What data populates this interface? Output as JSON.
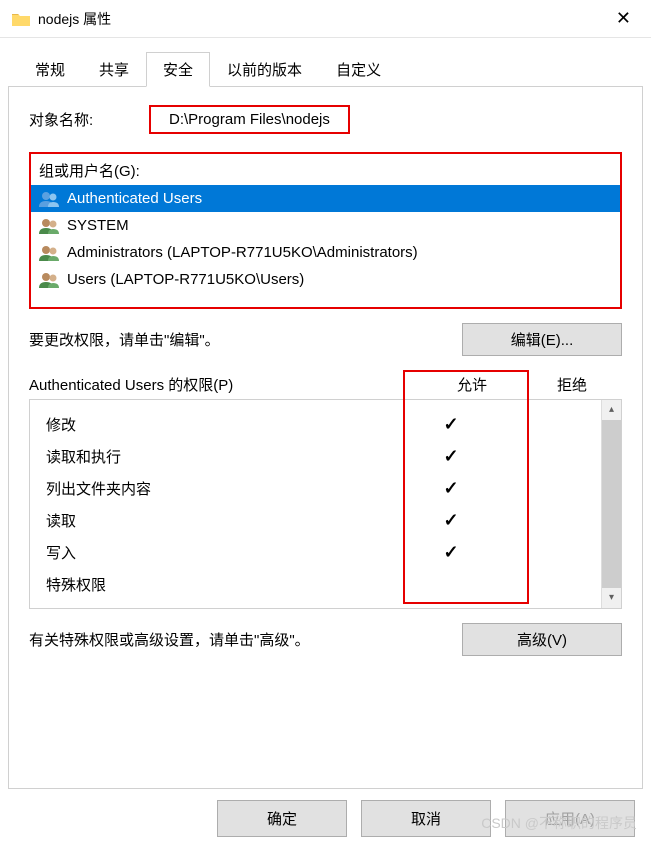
{
  "window": {
    "title": "nodejs 属性"
  },
  "tabs": [
    {
      "label": "常规"
    },
    {
      "label": "共享"
    },
    {
      "label": "安全",
      "active": true
    },
    {
      "label": "以前的版本"
    },
    {
      "label": "自定义"
    }
  ],
  "object": {
    "label": "对象名称:",
    "path": "D:\\Program Files\\nodejs"
  },
  "groups": {
    "label": "组或用户名(G):",
    "items": [
      {
        "name": "Authenticated Users",
        "selected": true
      },
      {
        "name": "SYSTEM"
      },
      {
        "name": "Administrators (LAPTOP-R771U5KO\\Administrators)"
      },
      {
        "name": "Users (LAPTOP-R771U5KO\\Users)"
      }
    ]
  },
  "edit": {
    "text": "要更改权限，请单击\"编辑\"。",
    "button": "编辑(E)..."
  },
  "perm": {
    "header": "Authenticated Users 的权限(P)",
    "allow": "允许",
    "deny": "拒绝",
    "rows": [
      {
        "name": "修改",
        "allow": true
      },
      {
        "name": "读取和执行",
        "allow": true
      },
      {
        "name": "列出文件夹内容",
        "allow": true
      },
      {
        "name": "读取",
        "allow": true
      },
      {
        "name": "写入",
        "allow": true
      },
      {
        "name": "特殊权限",
        "allow": false
      }
    ]
  },
  "advanced": {
    "text": "有关特殊权限或高级设置，请单击\"高级\"。",
    "button": "高级(V)"
  },
  "footer": {
    "ok": "确定",
    "cancel": "取消",
    "apply": "应用(A)"
  },
  "watermark": "CSDN @不称职的程序员"
}
